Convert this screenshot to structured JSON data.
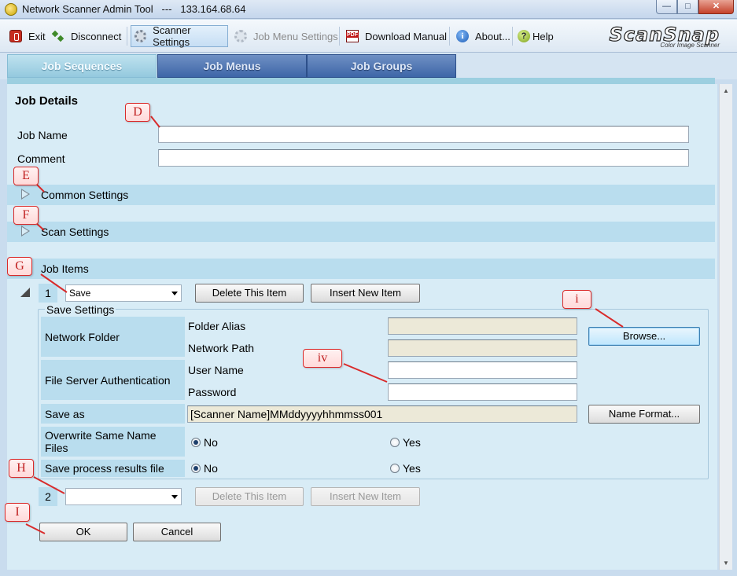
{
  "window": {
    "title": "Network Scanner Admin Tool   ---   133.164.68.64",
    "minimize_glyph": "—",
    "maximize_glyph": "□",
    "close_glyph": "✕"
  },
  "toolbar": {
    "exit_label": "Exit",
    "disconnect_label": "Disconnect",
    "scanner_settings_label": "Scanner Settings",
    "job_menu_settings_label": "Job Menu Settings",
    "download_manual_label": "Download Manual",
    "about_label": "About...",
    "help_label": "Help",
    "info_glyph": "i",
    "help_glyph": "?"
  },
  "logo": {
    "brand": "ScanSnap",
    "tagline": "Color Image Scanner"
  },
  "tabs": [
    {
      "label": "Job Sequences",
      "active": true
    },
    {
      "label": "Job Menus",
      "active": false
    },
    {
      "label": "Job Groups",
      "active": false
    }
  ],
  "job_details": {
    "heading": "Job Details",
    "job_name_label": "Job Name",
    "job_name_value": "",
    "comment_label": "Comment",
    "comment_value": ""
  },
  "sections": {
    "common_settings": "Common Settings",
    "scan_settings": "Scan Settings",
    "job_items": "Job Items"
  },
  "job_items": [
    {
      "number": "1",
      "type": "Save",
      "delete_label": "Delete This Item",
      "insert_label": "Insert New Item",
      "enabled": true
    },
    {
      "number": "2",
      "type": "",
      "delete_label": "Delete This Item",
      "insert_label": "Insert New Item",
      "enabled": false
    }
  ],
  "save_settings": {
    "title": "Save Settings",
    "network_folder_label": "Network Folder",
    "folder_alias_label": "Folder Alias",
    "folder_alias_value": "",
    "network_path_label": "Network Path",
    "network_path_value": "",
    "browse_label": "Browse...",
    "file_server_auth_label": "File Server Authentication",
    "user_name_label": "User Name",
    "user_name_value": "",
    "password_label": "Password",
    "password_value": "",
    "save_as_label": "Save as",
    "save_as_value": "[Scanner Name]MMddyyyyhhmmss001",
    "name_format_label": "Name Format...",
    "overwrite_label_line1": "Overwrite Same Name",
    "overwrite_label_line2": "Files",
    "overwrite_selected": "No",
    "process_results_label": "Save process results file",
    "process_results_selected": "No",
    "no_label": "No",
    "yes_label": "Yes"
  },
  "actions": {
    "ok_label": "OK",
    "cancel_label": "Cancel"
  },
  "callouts": {
    "D": "D",
    "E": "E",
    "F": "F",
    "G": "G",
    "H": "H",
    "I": "I",
    "i": "i",
    "iv": "iv"
  },
  "colors": {
    "tab_active": "#94c9de",
    "tab_inactive": "#3e66a8",
    "panel_bg": "#d8ecf6",
    "section_bar": "#b9ddee",
    "callout_border": "#d92b2b"
  }
}
